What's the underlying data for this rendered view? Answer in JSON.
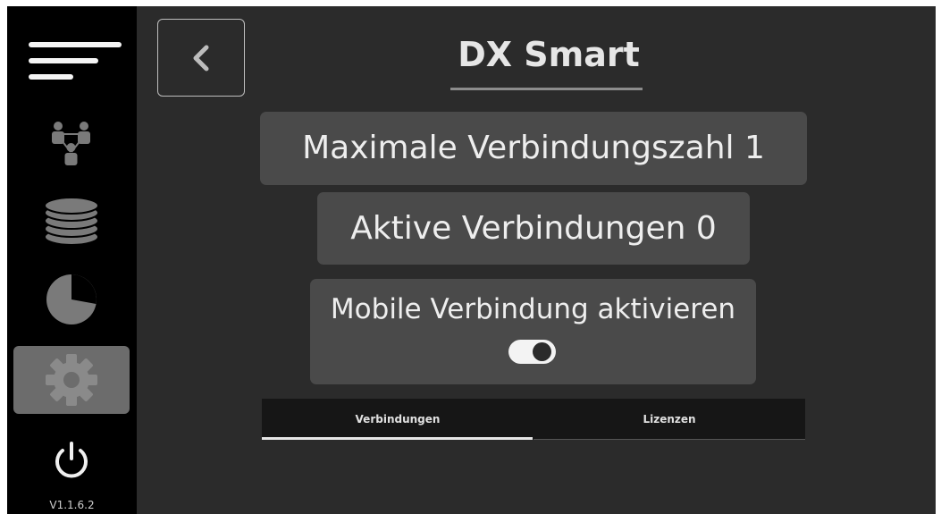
{
  "sidebar": {
    "items": [
      {
        "icon": "menu-icon"
      },
      {
        "icon": "network-users-icon"
      },
      {
        "icon": "database-icon"
      },
      {
        "icon": "pie-chart-icon"
      },
      {
        "icon": "gear-icon",
        "active": true
      },
      {
        "icon": "power-icon"
      }
    ],
    "version": "V1.1.6.2"
  },
  "header": {
    "back_icon": "chevron-left-icon",
    "title": "DX Smart"
  },
  "main": {
    "max_connections": "Maximale Verbindungszahl 1",
    "active_connections": "Aktive Verbindungen 0",
    "mobile_connection": {
      "label": "Mobile Verbindung aktivieren",
      "enabled": true
    },
    "tabs": [
      {
        "label": "Verbindungen",
        "selected": true
      },
      {
        "label": "Lizenzen",
        "selected": false
      }
    ]
  },
  "colors": {
    "background": "#2b2b2b",
    "sidebar": "#000000",
    "panel": "#4a4a4a",
    "active_nav": "#6c6c6c",
    "text": "#eeeeee"
  }
}
